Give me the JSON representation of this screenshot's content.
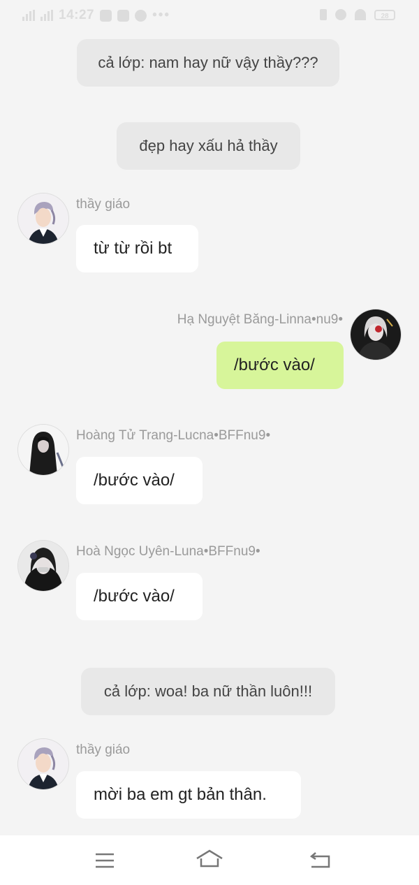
{
  "status_bar": {
    "time": "14:27",
    "dots": "•••",
    "battery": "28"
  },
  "messages": {
    "sys1": "cả lớp: nam hay nữ vậy thầy???",
    "sys2": "đẹp hay xấu hả thầy",
    "m1": {
      "sender": "thầy giáo",
      "text": "từ từ rồi bt"
    },
    "m2": {
      "sender": "Hạ Nguyệt Băng-Linna•nu9•",
      "text": "/bước vào/"
    },
    "m3": {
      "sender": "Hoàng Tử Trang-Lucna•BFFnu9•",
      "text": "/bước vào/"
    },
    "m4": {
      "sender": "Hoà Ngọc Uyên-Luna•BFFnu9•",
      "text": "/bước vào/"
    },
    "sys3": "cả lớp: woa! ba nữ thần luôn!!!",
    "m5": {
      "sender": "thầy giáo",
      "text": "mời ba em gt bản thân."
    }
  },
  "colors": {
    "background": "#f4f4f4",
    "incoming_bubble": "#ffffff",
    "outgoing_bubble": "#d7f59a",
    "system_bubble": "#e8e8e8",
    "sender_name": "#9a9a9a"
  },
  "nav": {
    "menu_icon": "menu-icon",
    "home_icon": "home-icon",
    "back_icon": "back-icon"
  }
}
